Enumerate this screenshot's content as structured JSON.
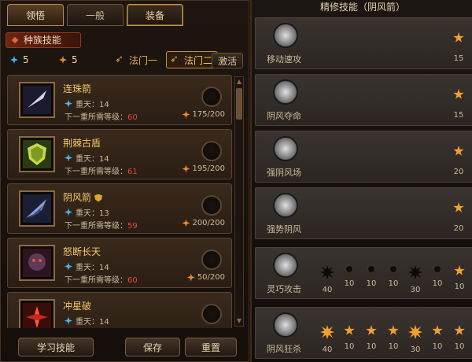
{
  "tabs": [
    {
      "label": "领悟"
    },
    {
      "label": "一般"
    },
    {
      "label": "装备"
    }
  ],
  "section_title": "种族技能",
  "stats": {
    "blue": "5",
    "orange": "5"
  },
  "modes": [
    {
      "label": "法门一"
    },
    {
      "label": "法门二"
    }
  ],
  "activate_label": "激活",
  "skills": [
    {
      "name": "连珠箭",
      "level_label": "重天：14",
      "req_label": "下一重所需等级：",
      "req_value": "60",
      "points": "175/200",
      "icon": "arrow-volley-icon"
    },
    {
      "name": "荆棘古盾",
      "level_label": "重天：14",
      "req_label": "下一重所需等级：",
      "req_value": "61",
      "points": "195/200",
      "icon": "thorn-shield-icon"
    },
    {
      "name": "阴风箭",
      "level_label": "重天：13",
      "req_label": "下一重所需等级：",
      "req_value": "59",
      "points": "200/200",
      "icon": "shadow-arrow-icon"
    },
    {
      "name": "怒断长天",
      "level_label": "重天：14",
      "req_label": "下一重所需等级：",
      "req_value": "60",
      "points": "50/200",
      "icon": "rage-portrait-icon"
    },
    {
      "name": "冲星破",
      "level_label": "重天：14",
      "req_label": "",
      "req_value": "",
      "points": "",
      "icon": "star-burst-icon"
    }
  ],
  "footer": {
    "learn": "学习技能",
    "save": "保存",
    "reset": "重置"
  },
  "refine_title": "精修技能（阴风箭）",
  "refine_rows": [
    {
      "label": "移动速攻",
      "star_value": "15"
    },
    {
      "label": "阴风夺命",
      "star_value": "15"
    },
    {
      "label": "强阴风场",
      "star_value": "20"
    },
    {
      "label": "强势阴风",
      "star_value": "20"
    },
    {
      "label": "灵巧攻击",
      "nodes": [
        "40",
        "10",
        "10",
        "10",
        "30",
        "10",
        "10"
      ]
    },
    {
      "label": "阴风狂杀",
      "nodes": [
        "40",
        "10",
        "10",
        "10",
        "30",
        "10",
        "10"
      ]
    }
  ]
}
